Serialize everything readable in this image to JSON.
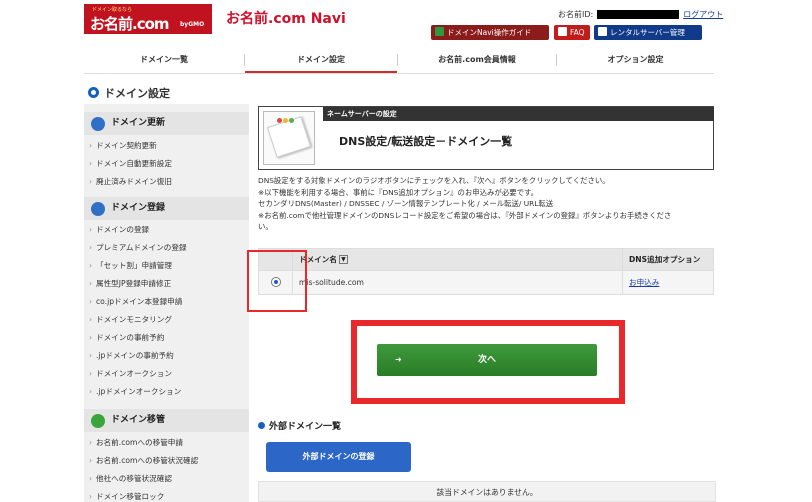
{
  "header": {
    "logo_tagline": "ドメイン取るなら",
    "logo_mark": "お名前.com",
    "logo_corp": "byGMO",
    "app_title": "お名前.com Navi",
    "user_id_label": "お名前ID:",
    "logout_label": "ログアウト",
    "buttons": {
      "guide": "ドメインNavi操作ガイド",
      "faq": "FAQ",
      "rental": "レンタルサーバー管理"
    }
  },
  "tabs": [
    "ドメイン一覧",
    "ドメイン設定",
    "お名前.com会員情報",
    "オプション設定"
  ],
  "active_tab": "ドメイン設定",
  "sidebar": {
    "title": "ドメイン設定",
    "sections": [
      {
        "label": "ドメイン更新",
        "items": [
          "ドメイン契約更新",
          "ドメイン自動更新設定",
          "廃止済みドメイン復旧"
        ]
      },
      {
        "label": "ドメイン登録",
        "items": [
          "ドメインの登録",
          "プレミアムドメインの登録",
          "「セット割」申請管理",
          "属性型JP登録申請修正",
          "co.jpドメイン本登録申請",
          "ドメインモニタリング",
          "ドメインの事前予約",
          ".jpドメインの事前予約",
          "ドメインオークション",
          ".jpドメインオークション"
        ]
      },
      {
        "label": "ドメイン移管",
        "items": [
          "お名前.comへの移管申請",
          "お名前.comへの移管状況確認",
          "他社への移管状況確認",
          "ドメイン移管ロック"
        ]
      }
    ]
  },
  "main": {
    "panel_label": "ネームサーバーの設定",
    "panel_title": "DNS設定/転送設定－ドメイン一覧",
    "description": [
      "DNS設定をする対象ドメインのラジオボタンにチェックを入れ、『次へ』ボタンをクリックしてください。",
      "※以下機能を利用する場合、事前に『DNS追加オプション』のお申込みが必要です。",
      "セカンダリDNS(Master) / DNSSEC / ゾーン情報テンプレート化 / メール転送/ URL転送",
      "※お名前.comで他社管理ドメインのDNSレコード設定をご希望の場合は、『外部ドメインの登録』ボタンよりお手続きくださ",
      "い。"
    ],
    "table": {
      "headers": [
        "",
        "ドメイン名",
        "DNS追加オプション"
      ],
      "rows": [
        {
          "selected": true,
          "domain": "mis-solitude.com",
          "option": "お申込み"
        }
      ]
    },
    "next_button": "次へ",
    "external_title": "外部ドメイン一覧",
    "external_button": "外部ドメインの登録",
    "no_domain_text": "該当ドメインはありません。"
  },
  "colors": {
    "accent_red": "#c1121f",
    "highlight_red": "#e8282b",
    "next_green": "#3f9a3c",
    "blue": "#2c67c8"
  }
}
